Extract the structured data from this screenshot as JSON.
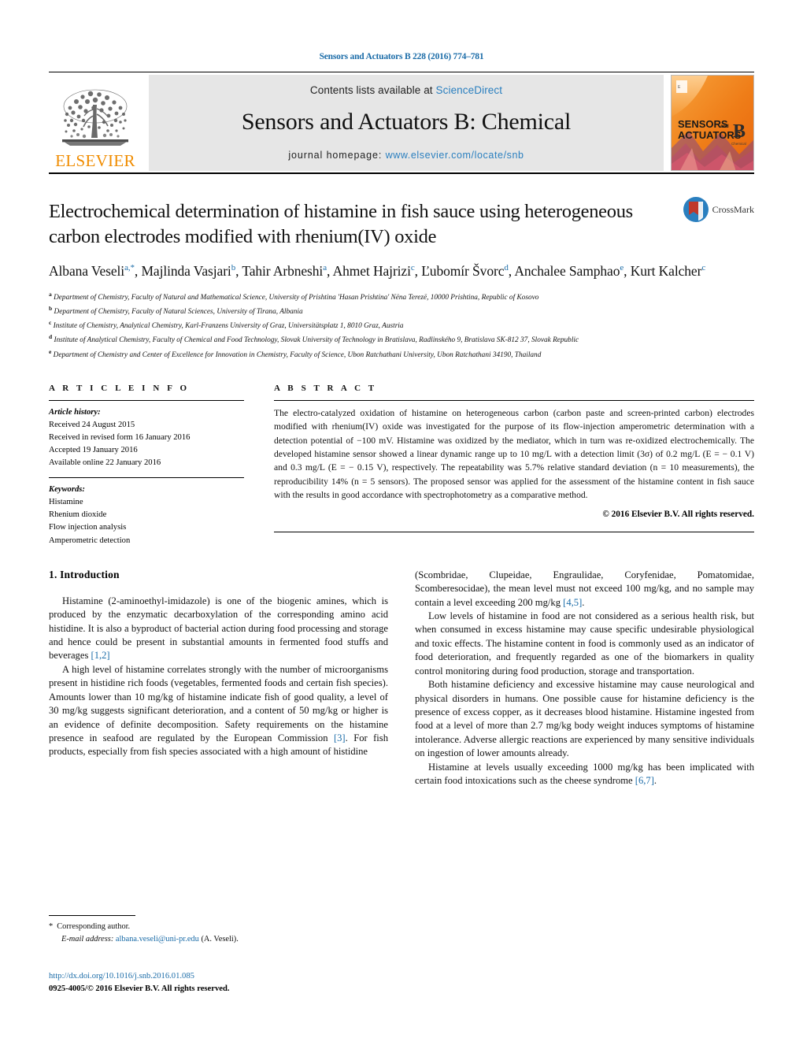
{
  "running_head": "Sensors and Actuators B 228 (2016) 774–781",
  "masthead": {
    "contents_prefix": "Contents lists available at ",
    "sciencedirect": "ScienceDirect",
    "journal_title": "Sensors and Actuators B: Chemical",
    "homepage_prefix": "journal homepage: ",
    "homepage_url": "www.elsevier.com/locate/snb",
    "publisher_wordmark": "ELSEVIER",
    "cover_line1": "SENSORS",
    "cover_and": "and",
    "cover_line2": "ACTUATORS",
    "cover_letter": "B",
    "cover_sub": "Chemical"
  },
  "article": {
    "title": "Electrochemical determination of histamine in fish sauce using heterogeneous carbon electrodes modified with rhenium(IV) oxide",
    "crossmark_label": "CrossMark",
    "authors_html": "Albana Veseli<sup>a,*</sup>, Majlinda Vasjari<sup>b</sup>, Tahir Arbneshi<sup>a</sup>, Ahmet Hajrizi<sup>c</sup>, Ľubomír Švorc<sup>d</sup>, Anchalee Samphao<sup>e</sup>, Kurt Kalcher<sup>c</sup>",
    "affiliations": [
      {
        "marker": "a",
        "text": "Department of Chemistry, Faculty of Natural and Mathematical Science, University of Prishtina 'Hasan Prishtina' Nëna Terezë, 10000 Prishtina, Republic of Kosovo"
      },
      {
        "marker": "b",
        "text": "Department of Chemistry, Faculty of Natural Sciences, University of Tirana, Albania"
      },
      {
        "marker": "c",
        "text": "Institute of Chemistry, Analytical Chemistry, Karl-Franzens University of Graz, Universitätsplatz 1, 8010 Graz, Austria"
      },
      {
        "marker": "d",
        "text": "Institute of Analytical Chemistry, Faculty of Chemical and Food Technology, Slovak University of Technology in Bratislava, Radlinského 9, Bratislava SK-812 37, Slovak Republic"
      },
      {
        "marker": "e",
        "text": "Department of Chemistry and Center of Excellence for Innovation in Chemistry, Faculty of Science, Ubon Ratchathani University, Ubon Ratchathani 34190, Thailand"
      }
    ]
  },
  "article_info": {
    "heading": "A R T I C L E   I N F O",
    "history_label": "Article history:",
    "history": [
      "Received 24 August 2015",
      "Received in revised form 16 January 2016",
      "Accepted 19 January 2016",
      "Available online 22 January 2016"
    ],
    "keywords_label": "Keywords:",
    "keywords": [
      "Histamine",
      "Rhenium dioxide",
      "Flow injection analysis",
      "Amperometric detection"
    ]
  },
  "abstract": {
    "heading": "A B S T R A C T",
    "text": "The electro-catalyzed oxidation of histamine on heterogeneous carbon (carbon paste and screen-printed carbon) electrodes modified with rhenium(IV) oxide was investigated for the purpose of its flow-injection amperometric determination with a detection potential of −100 mV. Histamine was oxidized by the mediator, which in turn was re-oxidized electrochemically. The developed histamine sensor showed a linear dynamic range up to 10 mg/L with a detection limit (3σ) of 0.2 mg/L (E = − 0.1 V) and 0.3 mg/L (E = − 0.15 V), respectively. The repeatability was 5.7% relative standard deviation (n = 10 measurements), the reproducibility 14% (n = 5 sensors). The proposed sensor was applied for the assessment of the histamine content in fish sauce with the results in good accordance with spectrophotometry as a comparative method.",
    "copyright": "© 2016 Elsevier B.V. All rights reserved."
  },
  "introduction": {
    "section_number_title": "1.  Introduction",
    "left_paragraphs": [
      "Histamine (2-aminoethyl-imidazole) is one of the biogenic amines, which is produced by the enzymatic decarboxylation of the corresponding amino acid histidine. It is also a byproduct of bacterial action during food processing and storage and hence could be present in substantial amounts in fermented food stuffs and beverages [1,2]",
      "A high level of histamine correlates strongly with the number of microorganisms present in histidine rich foods (vegetables, fermented foods and certain fish species). Amounts lower than 10 mg/kg of histamine indicate fish of good quality, a level of 30 mg/kg suggests significant deterioration, and a content of 50 mg/kg or higher is an evidence of definite decomposition. Safety requirements on the histamine presence in seafood are regulated by the European Commission [3]. For fish products, especially from fish species associated with a high amount of histidine"
    ],
    "right_paragraphs": [
      "(Scombridae, Clupeidae, Engraulidae, Coryfenidae, Pomatomidae, Scomberesocidae), the mean level must not exceed 100 mg/kg, and no sample may contain a level exceeding 200 mg/kg [4,5].",
      "Low levels of histamine in food are not considered as a serious health risk, but when consumed in excess histamine may cause specific undesirable physiological and toxic effects. The histamine content in food is commonly used as an indicator of food deterioration, and frequently regarded as one of the biomarkers in quality control monitoring during food production, storage and transportation.",
      "Both histamine deficiency and excessive histamine may cause neurological and physical disorders in humans. One possible cause for histamine deficiency is the presence of excess copper, as it decreases blood histamine. Histamine ingested from food at a level of more than 2.7 mg/kg body weight induces symptoms of histamine intolerance. Adverse allergic reactions are experienced by many sensitive individuals on ingestion of lower amounts already.",
      "Histamine at levels usually exceeding 1000 mg/kg has been implicated with certain food intoxications such as the cheese syndrome [6,7]."
    ]
  },
  "footnotes": {
    "corresponding_star": "*",
    "corresponding_text": "Corresponding author.",
    "email_label": "E-mail address:",
    "email": "albana.veseli@uni-pr.edu",
    "email_suffix": "(A. Veseli).",
    "doi_url": "http://dx.doi.org/10.1016/j.snb.2016.01.085",
    "issn_line": "0925-4005/© 2016 Elsevier B.V. All rights reserved."
  },
  "colors": {
    "link_blue": "#1b6ca8",
    "sciencedirect_blue": "#2a7fbf",
    "elsevier_orange": "#f08c00",
    "band_gray": "#e6e6e6",
    "crossmark_red": "#c0392b",
    "crossmark_blue": "#2a7fbf"
  }
}
